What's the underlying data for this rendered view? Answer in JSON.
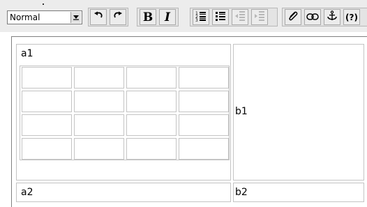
{
  "toolbar": {
    "format_select": {
      "value": "Normal"
    },
    "buttons": {
      "undo": "undo-icon",
      "redo": "redo-icon",
      "bold": "B",
      "italic": "I",
      "ordered_list": "ordered-list-icon",
      "unordered_list": "unordered-list-icon",
      "outdent": "outdent-icon",
      "indent": "indent-icon",
      "attach": "paperclip-icon",
      "link": "link-icon",
      "anchor": "anchor-icon",
      "help": "(?)"
    }
  },
  "editor": {
    "table": {
      "cells": {
        "a1": "a1",
        "b1": "b1",
        "a2": "a2",
        "b2": "b2"
      },
      "inner_table": {
        "rows": 4,
        "cols": 4
      }
    }
  }
}
